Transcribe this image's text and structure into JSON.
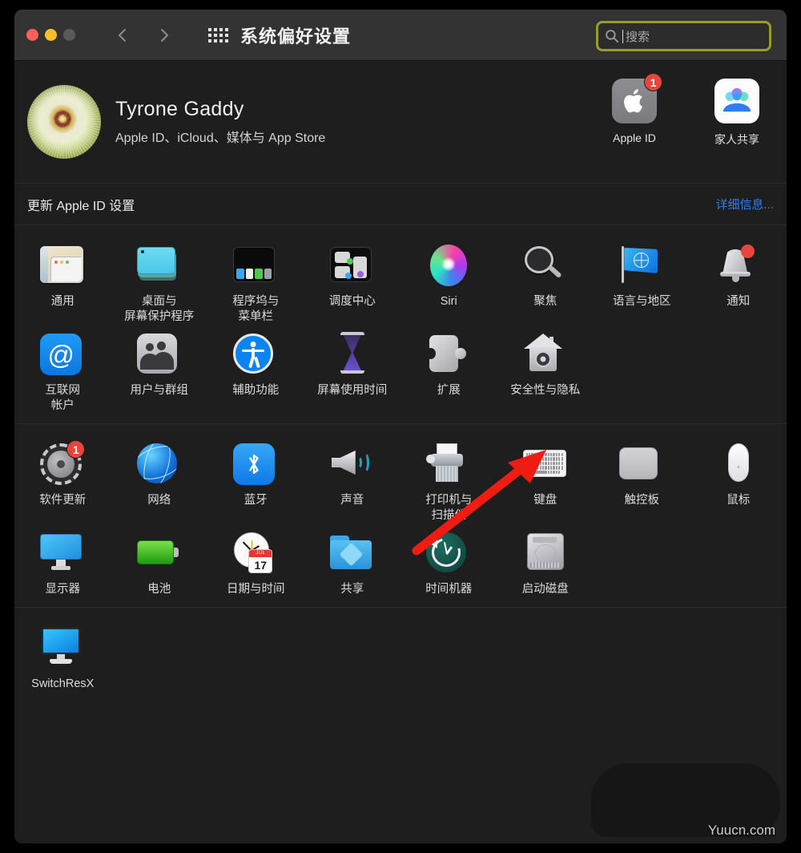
{
  "window": {
    "title": "系统偏好设置",
    "traffic_lights": [
      "close-button",
      "minimize-button",
      "zoom-button"
    ],
    "back_label": "‹",
    "forward_label": "›",
    "grid_view_label": "show-all-icon"
  },
  "search": {
    "placeholder": "搜索",
    "value": "",
    "focus_ring_color": "#9a9a32"
  },
  "account": {
    "name": "Tyrone Gaddy",
    "subtitle": "Apple ID、iCloud、媒体与 App Store",
    "avatar_name": "dandelion-avatar",
    "buttons": [
      {
        "label": "Apple ID",
        "icon": "apple-logo-icon",
        "badge": "1"
      },
      {
        "label": "家人共享",
        "icon": "family-sharing-icon",
        "badge": ""
      }
    ]
  },
  "update_strip": {
    "label": "更新 Apple ID 设置",
    "link": "详细信息...",
    "link_color": "#2f7df6"
  },
  "sections": [
    {
      "name": "personal-section",
      "rows": [
        [
          {
            "label": "通用",
            "icon": "general-icon"
          },
          {
            "label": "桌面与\n屏幕保护程序",
            "icon": "desktop-screensaver-icon"
          },
          {
            "label": "程序坞与\n菜单栏",
            "icon": "dock-menubar-icon"
          },
          {
            "label": "调度中心",
            "icon": "mission-control-icon"
          },
          {
            "label": "Siri",
            "icon": "siri-icon"
          },
          {
            "label": "聚焦",
            "icon": "spotlight-icon"
          },
          {
            "label": "语言与地区",
            "icon": "language-region-icon"
          },
          {
            "label": "通知",
            "icon": "notifications-icon",
            "badge": "dot"
          }
        ],
        [
          {
            "label": "互联网\n帐户",
            "icon": "internet-accounts-icon"
          },
          {
            "label": "用户与群组",
            "icon": "users-groups-icon"
          },
          {
            "label": "辅助功能",
            "icon": "accessibility-icon"
          },
          {
            "label": "屏幕使用时间",
            "icon": "screen-time-icon"
          },
          {
            "label": "扩展",
            "icon": "extensions-icon"
          },
          {
            "label": "安全性与隐私",
            "icon": "security-privacy-icon"
          }
        ]
      ]
    },
    {
      "name": "hardware-section",
      "rows": [
        [
          {
            "label": "软件更新",
            "icon": "software-update-icon",
            "badge": "1"
          },
          {
            "label": "网络",
            "icon": "network-icon"
          },
          {
            "label": "蓝牙",
            "icon": "bluetooth-icon"
          },
          {
            "label": "声音",
            "icon": "sound-icon"
          },
          {
            "label": "打印机与\n扫描仪",
            "icon": "printers-scanners-icon"
          },
          {
            "label": "键盘",
            "icon": "keyboard-icon"
          },
          {
            "label": "触控板",
            "icon": "trackpad-icon"
          },
          {
            "label": "鼠标",
            "icon": "mouse-icon"
          }
        ],
        [
          {
            "label": "显示器",
            "icon": "displays-icon"
          },
          {
            "label": "电池",
            "icon": "battery-icon"
          },
          {
            "label": "日期与时间",
            "icon": "date-time-icon",
            "calendar_month": "JUL",
            "calendar_day": "17"
          },
          {
            "label": "共享",
            "icon": "sharing-icon"
          },
          {
            "label": "时间机器",
            "icon": "time-machine-icon"
          },
          {
            "label": "启动磁盘",
            "icon": "startup-disk-icon"
          }
        ]
      ]
    },
    {
      "name": "third-party-section",
      "rows": [
        [
          {
            "label": "SwitchResX",
            "icon": "switchresx-icon"
          }
        ]
      ]
    }
  ],
  "annotation": {
    "arrow_color": "#ee1c12",
    "arrow_target": "键盘"
  },
  "watermark": {
    "text": "Yuucn.com"
  }
}
